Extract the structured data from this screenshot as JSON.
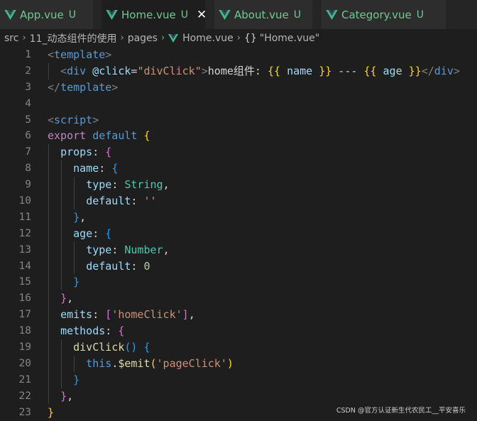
{
  "tabs": [
    {
      "label": "App.vue",
      "status": "U",
      "active": false
    },
    {
      "label": "Home.vue",
      "status": "U",
      "active": true
    },
    {
      "label": "About.vue",
      "status": "U",
      "active": false
    },
    {
      "label": "Category.vue",
      "status": "U",
      "active": false
    }
  ],
  "tab_close_glyph": "✕",
  "breadcrumb": {
    "items": [
      "src",
      "11_动态组件的使用",
      "pages",
      "Home.vue"
    ],
    "separator": "›",
    "symbol_icon": "{}",
    "symbol": "\"Home.vue\""
  },
  "line_numbers": [
    "1",
    "2",
    "3",
    "4",
    "5",
    "6",
    "7",
    "8",
    "9",
    "10",
    "11",
    "12",
    "13",
    "14",
    "15",
    "16",
    "17",
    "18",
    "19",
    "20",
    "21",
    "22",
    "23"
  ],
  "code_lines": [
    [
      [
        "t-punc",
        "<"
      ],
      [
        "t-tag",
        "template"
      ],
      [
        "t-punc",
        ">"
      ]
    ],
    [
      [
        "t-text",
        "  "
      ],
      [
        "t-punc",
        "<"
      ],
      [
        "t-tag",
        "div"
      ],
      [
        "t-text",
        " "
      ],
      [
        "t-attr",
        "@click"
      ],
      [
        "t-text",
        "="
      ],
      [
        "t-str",
        "\"divClick\""
      ],
      [
        "t-punc",
        ">"
      ],
      [
        "t-text",
        "home组件: "
      ],
      [
        "t-br",
        "{{"
      ],
      [
        "t-text",
        " "
      ],
      [
        "t-prop",
        "name"
      ],
      [
        "t-text",
        " "
      ],
      [
        "t-br",
        "}}"
      ],
      [
        "t-text",
        " --- "
      ],
      [
        "t-br",
        "{{"
      ],
      [
        "t-text",
        " "
      ],
      [
        "t-prop",
        "age"
      ],
      [
        "t-text",
        " "
      ],
      [
        "t-br",
        "}}"
      ],
      [
        "t-punc",
        "</"
      ],
      [
        "t-tag",
        "div"
      ],
      [
        "t-punc",
        ">"
      ]
    ],
    [
      [
        "t-punc",
        "</"
      ],
      [
        "t-tag",
        "template"
      ],
      [
        "t-punc",
        ">"
      ]
    ],
    [],
    [
      [
        "t-punc",
        "<"
      ],
      [
        "t-tag",
        "script"
      ],
      [
        "t-punc",
        ">"
      ]
    ],
    [
      [
        "t-kw",
        "export"
      ],
      [
        "t-text",
        " "
      ],
      [
        "t-kw2",
        "default"
      ],
      [
        "t-text",
        " "
      ],
      [
        "t-br",
        "{"
      ]
    ],
    [
      [
        "t-text",
        "  "
      ],
      [
        "t-prop",
        "props"
      ],
      [
        "t-text",
        ": "
      ],
      [
        "t-br2",
        "{"
      ]
    ],
    [
      [
        "t-text",
        "    "
      ],
      [
        "t-prop",
        "name"
      ],
      [
        "t-text",
        ": "
      ],
      [
        "t-br3",
        "{"
      ]
    ],
    [
      [
        "t-text",
        "      "
      ],
      [
        "t-prop",
        "type"
      ],
      [
        "t-text",
        ": "
      ],
      [
        "t-type",
        "String"
      ],
      [
        "t-text",
        ","
      ]
    ],
    [
      [
        "t-text",
        "      "
      ],
      [
        "t-prop",
        "default"
      ],
      [
        "t-text",
        ": "
      ],
      [
        "t-str",
        "''"
      ]
    ],
    [
      [
        "t-text",
        "    "
      ],
      [
        "t-br3",
        "}"
      ],
      [
        "t-text",
        ","
      ]
    ],
    [
      [
        "t-text",
        "    "
      ],
      [
        "t-prop",
        "age"
      ],
      [
        "t-text",
        ": "
      ],
      [
        "t-br3",
        "{"
      ]
    ],
    [
      [
        "t-text",
        "      "
      ],
      [
        "t-prop",
        "type"
      ],
      [
        "t-text",
        ": "
      ],
      [
        "t-type",
        "Number"
      ],
      [
        "t-text",
        ","
      ]
    ],
    [
      [
        "t-text",
        "      "
      ],
      [
        "t-prop",
        "default"
      ],
      [
        "t-text",
        ": "
      ],
      [
        "t-num",
        "0"
      ]
    ],
    [
      [
        "t-text",
        "    "
      ],
      [
        "t-br3",
        "}"
      ]
    ],
    [
      [
        "t-text",
        "  "
      ],
      [
        "t-br2",
        "}"
      ],
      [
        "t-text",
        ","
      ]
    ],
    [
      [
        "t-text",
        "  "
      ],
      [
        "t-prop",
        "emits"
      ],
      [
        "t-text",
        ": "
      ],
      [
        "t-br2",
        "["
      ],
      [
        "t-str",
        "'homeClick'"
      ],
      [
        "t-br2",
        "]"
      ],
      [
        "t-text",
        ","
      ]
    ],
    [
      [
        "t-text",
        "  "
      ],
      [
        "t-prop",
        "methods"
      ],
      [
        "t-text",
        ": "
      ],
      [
        "t-br2",
        "{"
      ]
    ],
    [
      [
        "t-text",
        "    "
      ],
      [
        "t-fn",
        "divClick"
      ],
      [
        "t-br3",
        "()"
      ],
      [
        "t-text",
        " "
      ],
      [
        "t-br3",
        "{"
      ]
    ],
    [
      [
        "t-text",
        "      "
      ],
      [
        "t-kw2",
        "this"
      ],
      [
        "t-text",
        "."
      ],
      [
        "t-fn",
        "$emit"
      ],
      [
        "t-br",
        "("
      ],
      [
        "t-str",
        "'pageClick'"
      ],
      [
        "t-br",
        ")"
      ]
    ],
    [
      [
        "t-text",
        "    "
      ],
      [
        "t-br3",
        "}"
      ]
    ],
    [
      [
        "t-text",
        "  "
      ],
      [
        "t-br2",
        "}"
      ],
      [
        "t-text",
        ","
      ]
    ],
    [
      [
        "t-br",
        "}"
      ]
    ]
  ],
  "watermark": "CSDN @官方认证新生代农民工__平安喜乐",
  "colors": {
    "editor_bg": "#1e1e1e",
    "tab_text": "#73c991",
    "vue_green": "#41b883",
    "vue_dark": "#35495e"
  }
}
